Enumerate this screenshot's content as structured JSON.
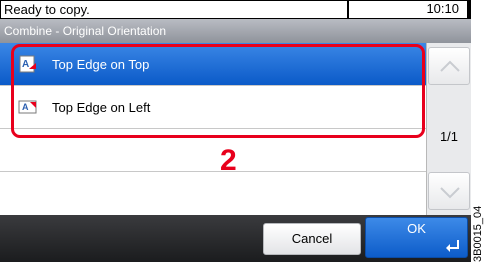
{
  "status": {
    "message": "Ready to copy.",
    "time": "10:10"
  },
  "title": "Combine - Original Orientation",
  "options": [
    {
      "label": "Top Edge on Top",
      "icon": "page-top-edge-icon",
      "selected": true
    },
    {
      "label": "Top Edge on Left",
      "icon": "page-left-edge-icon",
      "selected": false
    }
  ],
  "pagination": {
    "label": "1/1"
  },
  "callout": {
    "number": "2"
  },
  "buttons": {
    "cancel": "Cancel",
    "ok": "OK"
  },
  "reference_code": "3B0015_04",
  "colors": {
    "selected": "#0b5ac8",
    "highlight": "#e8001c",
    "bottom_bar": "#1b1c1e"
  }
}
